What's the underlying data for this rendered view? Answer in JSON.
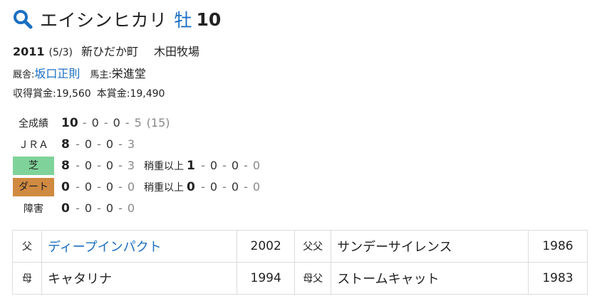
{
  "header": {
    "icon": "search-icon",
    "icon_color": "#1b6fc2",
    "horse_name": "エイシンヒカリ",
    "sex": "牡",
    "age": "10"
  },
  "birth": {
    "year": "2011",
    "month_day": "(5/3)",
    "town": "新ひだか町",
    "breeder": "木田牧場"
  },
  "stable": {
    "trainer_label": "厩舎:",
    "trainer": "坂口正則",
    "owner_label": "馬主:",
    "owner": "栄進堂"
  },
  "prize": {
    "earned_label": "収得賞金:",
    "earned": "19,560",
    "main_label": "本賞金:",
    "main": "19,490"
  },
  "records": [
    {
      "label": "全成績",
      "w": "10",
      "a": "0",
      "b": "0",
      "c": "5",
      "total": "(15)"
    },
    {
      "label": "ＪＲＡ",
      "w": "8",
      "a": "0",
      "b": "0",
      "c": "3"
    },
    {
      "label": "芝",
      "w": "8",
      "a": "0",
      "b": "0",
      "c": "3",
      "sub_label": "稍重以上",
      "sw": "1",
      "sa": "0",
      "sb": "0",
      "sc": "0"
    },
    {
      "label": "ダート",
      "w": "0",
      "a": "0",
      "b": "0",
      "c": "0",
      "sub_label": "稍重以上",
      "sw": "0",
      "sa": "0",
      "sb": "0",
      "sc": "0"
    },
    {
      "label": "障害",
      "w": "0",
      "a": "0",
      "b": "0",
      "c": "0"
    }
  ],
  "separator": "-",
  "colors": {
    "turf": "#7fd39a",
    "dirt": "#d08a41",
    "link": "#1b6fc2"
  },
  "pedigree": {
    "rows": [
      {
        "rel": "父",
        "name": "ディープインパクト",
        "year": "2002",
        "rel2": "父父",
        "name2": "サンデーサイレンス",
        "year2": "1986"
      },
      {
        "rel": "母",
        "name": "キャタリナ",
        "year": "1994",
        "rel2": "母父",
        "name2": "ストームキャット",
        "year2": "1983"
      }
    ]
  }
}
